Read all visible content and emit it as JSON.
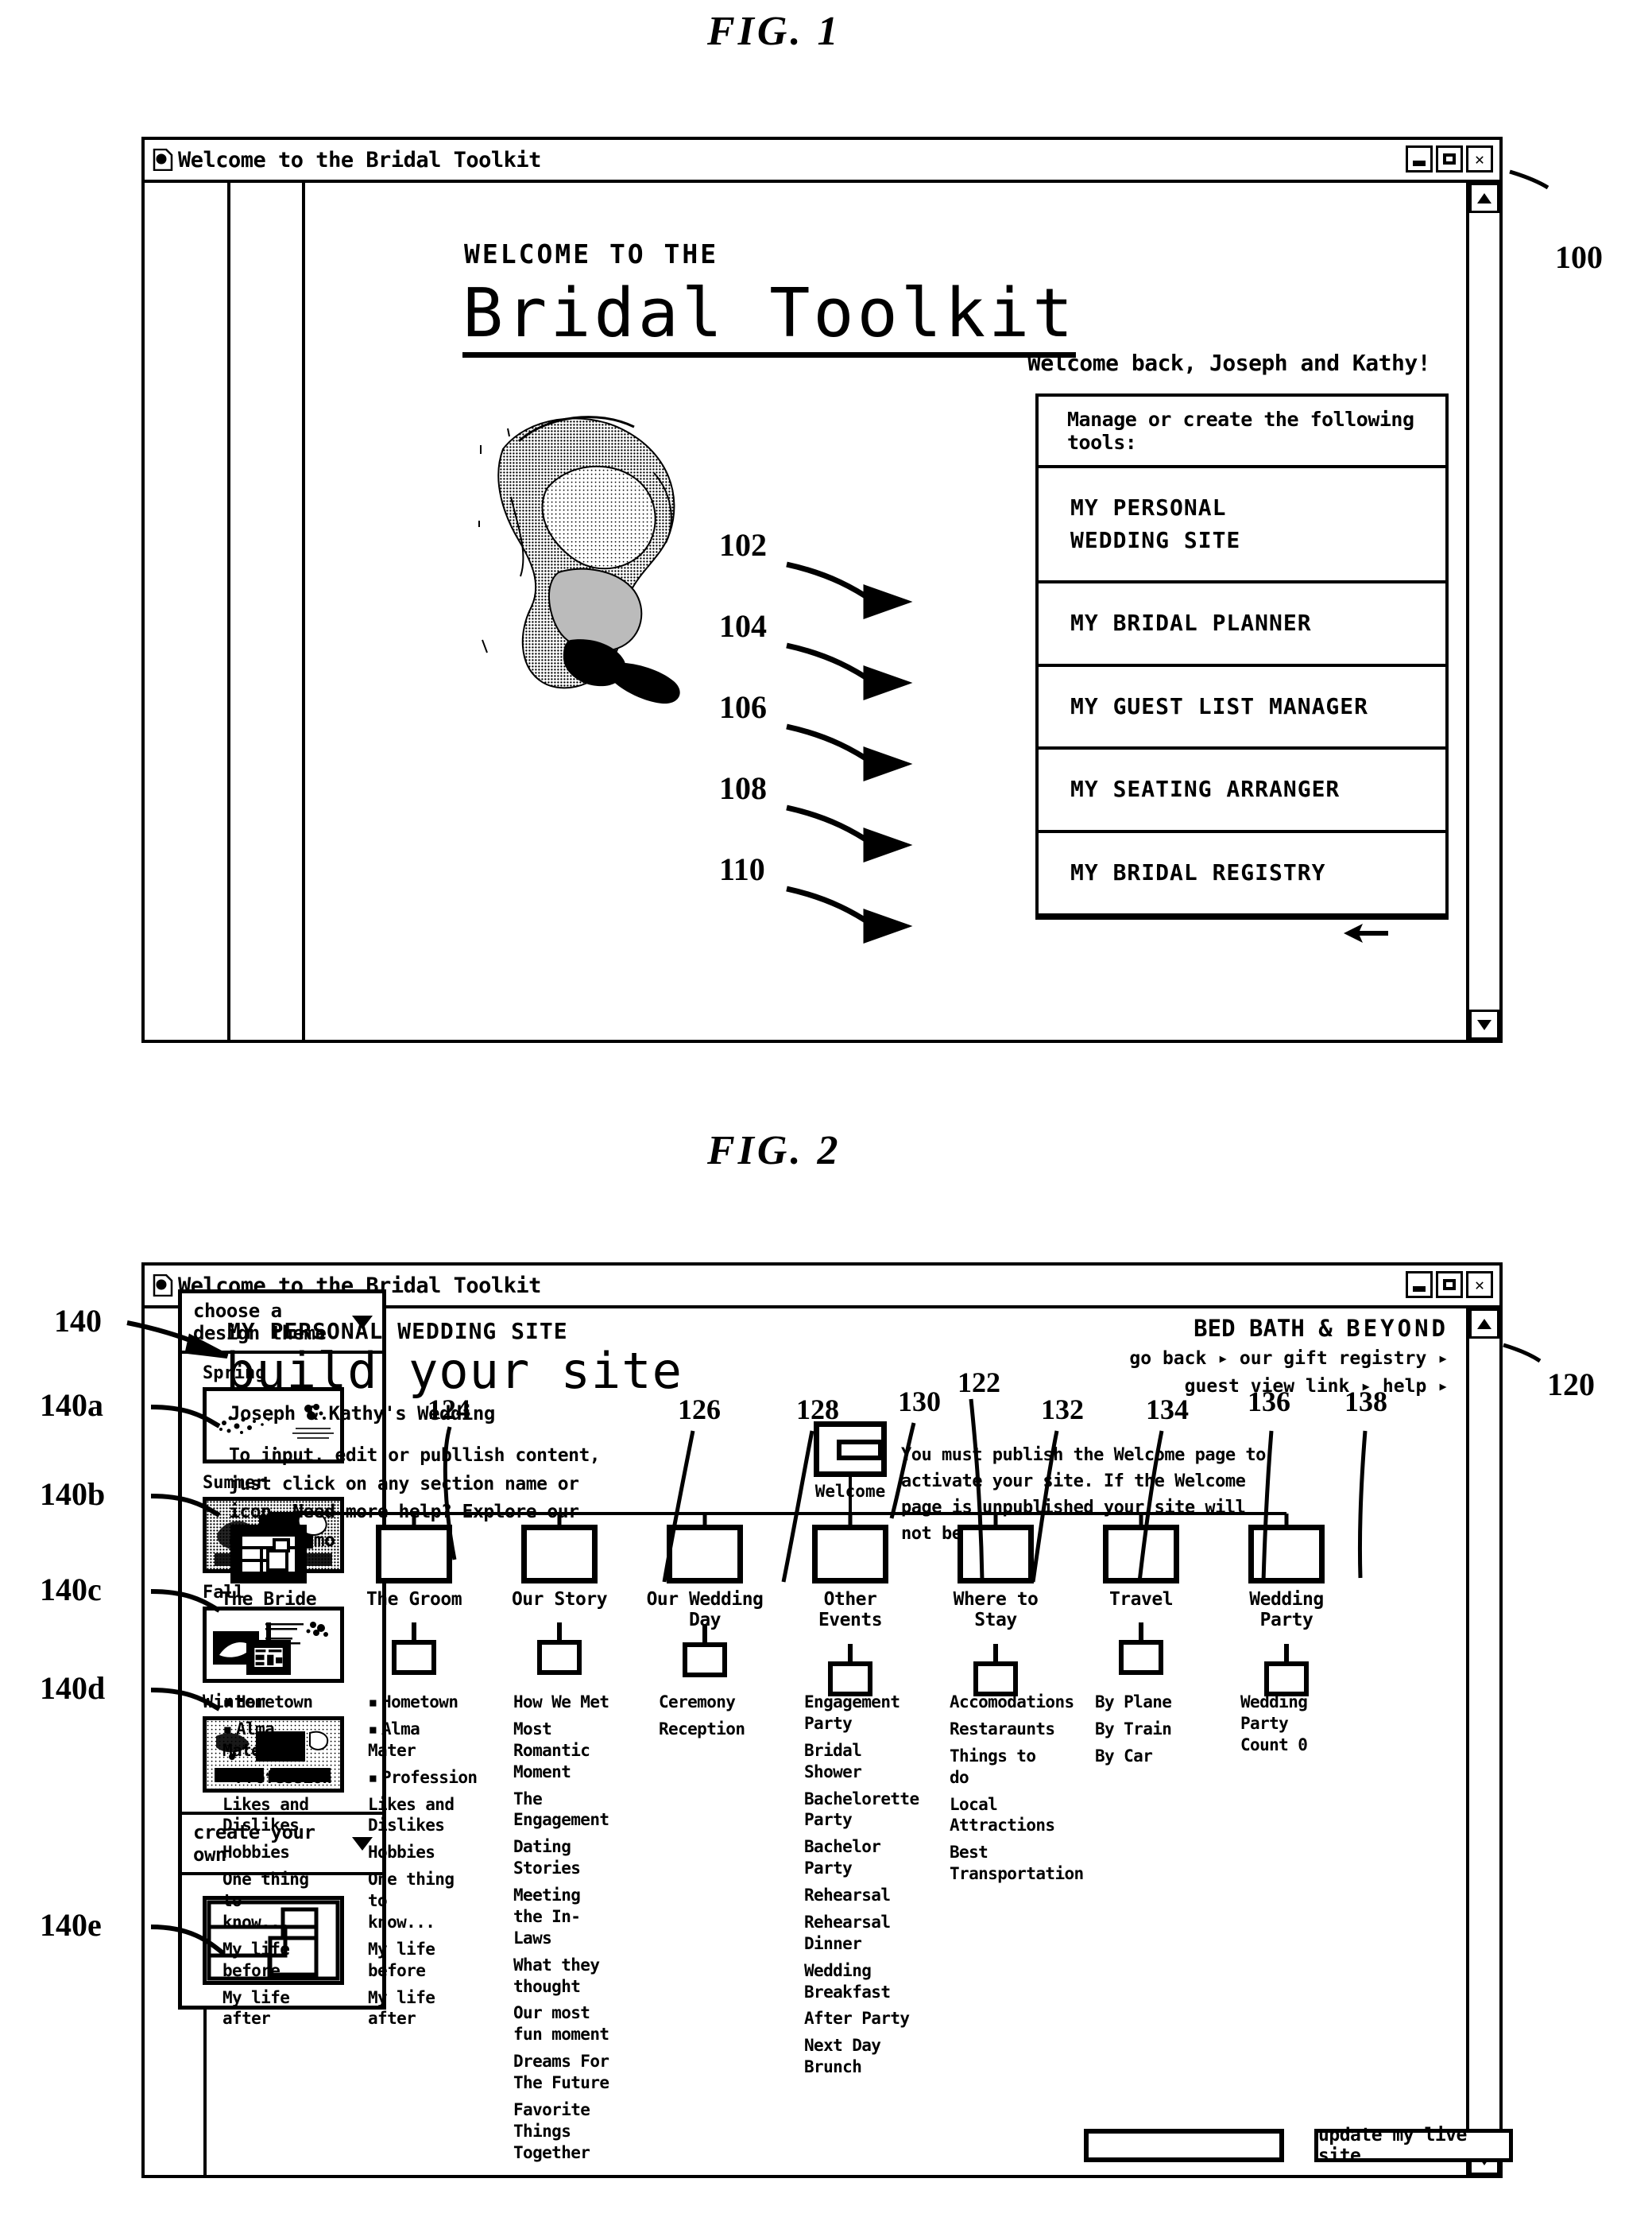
{
  "figures": [
    {
      "label": "FIG. 1",
      "ref": "100"
    },
    {
      "label": "FIG. 2",
      "ref": "120"
    }
  ],
  "fig1": {
    "window": {
      "title": "Welcome to the Bridal Toolkit",
      "icon": "document-icon",
      "controls": {
        "minimize": "minimize-icon",
        "maximize": "maximize-icon",
        "close": "✕"
      }
    },
    "kicker": "WELCOME TO THE",
    "brand": "Bridal Toolkit",
    "welcome_back": "Welcome back, Joseph and Kathy!",
    "photo_alt": "bride-photograph",
    "menu": {
      "heading": "Manage or create the following tools:",
      "items": [
        {
          "ref": "102",
          "label": "MY PERSONAL\nWEDDING SITE"
        },
        {
          "ref": "104",
          "label": "MY BRIDAL PLANNER"
        },
        {
          "ref": "106",
          "label": "MY GUEST LIST MANAGER"
        },
        {
          "ref": "108",
          "label": "MY SEATING ARRANGER"
        },
        {
          "ref": "110",
          "label": "MY BRIDAL REGISTRY"
        }
      ]
    },
    "scrollbar": {
      "up": "scroll-up-icon",
      "down": "scroll-down-icon"
    }
  },
  "fig2": {
    "window": {
      "title": "Welcome to the Bridal Toolkit",
      "icon": "document-icon",
      "controls": {
        "minimize": "minimize-icon",
        "maximize": "maximize-icon",
        "close": "✕"
      }
    },
    "theme_panel": {
      "ref": "140",
      "header": "choose a design theme",
      "caret": "chevron-down-icon",
      "themes": [
        {
          "ref": "140a",
          "name": "Spring"
        },
        {
          "ref": "140b",
          "name": "Summer"
        },
        {
          "ref": "140c",
          "name": "Fall"
        },
        {
          "ref": "140d",
          "name": "Winter"
        }
      ],
      "create_own": {
        "ref": "140e",
        "label": "create your own",
        "caret": "chevron-down-icon"
      }
    },
    "header": {
      "kicker": "MY PERSONAL WEDDING SITE",
      "title": "build your site",
      "subtitle": "Joseph & Kathy's Wedding",
      "instructions": "To input, edit or publlish content, just click on any section name or icon. Need more help? Explore our quick demo",
      "instr_ref": "124"
    },
    "partner": {
      "brand_bold": "BED BATH &",
      "brand_spaced": "BEYOND",
      "nav_line1": "go back ▸  our gift registry ▸",
      "nav_line2": "guest view link ▸ help ▸"
    },
    "notice": {
      "ref_start": "134",
      "text": "You must publish the Welcome page to activate your site. If the Welcome page is unpublished your site will not be seen."
    },
    "welcome_node": {
      "ref": "122",
      "label": "Welcome",
      "icon": "welcome-page-icon"
    },
    "callout_refs": [
      "126",
      "128",
      "130",
      "132",
      "134",
      "136",
      "138"
    ],
    "sections": [
      {
        "name": "The Bride",
        "selected": true,
        "items": [
          "Hometown",
          "Alma Mater",
          "Profession",
          "Likes and Dislikes",
          "Hobbies",
          "One thing to know...",
          "My life before",
          "My life after"
        ],
        "bulleted": 3
      },
      {
        "name": "The Groom",
        "selected": false,
        "items": [
          "Hometown",
          "Alma Mater",
          "Profession",
          "Likes and Dislikes",
          "Hobbies",
          "One thing to know...",
          "My life before",
          "My life after"
        ],
        "bulleted": 3
      },
      {
        "name": "Our Story",
        "selected": false,
        "items": [
          "How We Met",
          "Most Romantic Moment",
          "The Engagement",
          "Dating Stories",
          "Meeting the In-Laws",
          "What they thought",
          "Our most fun moment",
          "Dreams For The Future",
          "Favorite Things Together"
        ],
        "bulleted": 0
      },
      {
        "name": "Our Wedding Day",
        "selected": false,
        "items": [
          "Ceremony",
          "Reception"
        ],
        "bulleted": 0
      },
      {
        "name": "Other Events",
        "selected": false,
        "items": [
          "Engagement Party",
          "Bridal Shower",
          "Bachelorette Party",
          "Bachelor Party",
          "Rehearsal",
          "Rehearsal Dinner",
          "Wedding Breakfast",
          "After Party",
          "Next Day Brunch"
        ],
        "bulleted": 0
      },
      {
        "name": "Where to Stay",
        "selected": false,
        "items": [
          "Accomodations",
          "Restaraunts",
          "Things to do",
          "Local Attractions",
          "Best Transportation"
        ],
        "bulleted": 0
      },
      {
        "name": "Travel",
        "selected": false,
        "items": [
          "By Plane",
          "By Train",
          "By Car"
        ],
        "bulleted": 0
      },
      {
        "name": "Wedding Party",
        "selected": false,
        "items": [
          "Wedding Party Count 0"
        ],
        "bulleted": 0
      }
    ],
    "footer": {
      "blank_field_value": "",
      "update_button": "update my live site"
    },
    "scrollbar": {
      "up": "scroll-up-icon",
      "down": "scroll-down-icon"
    }
  }
}
